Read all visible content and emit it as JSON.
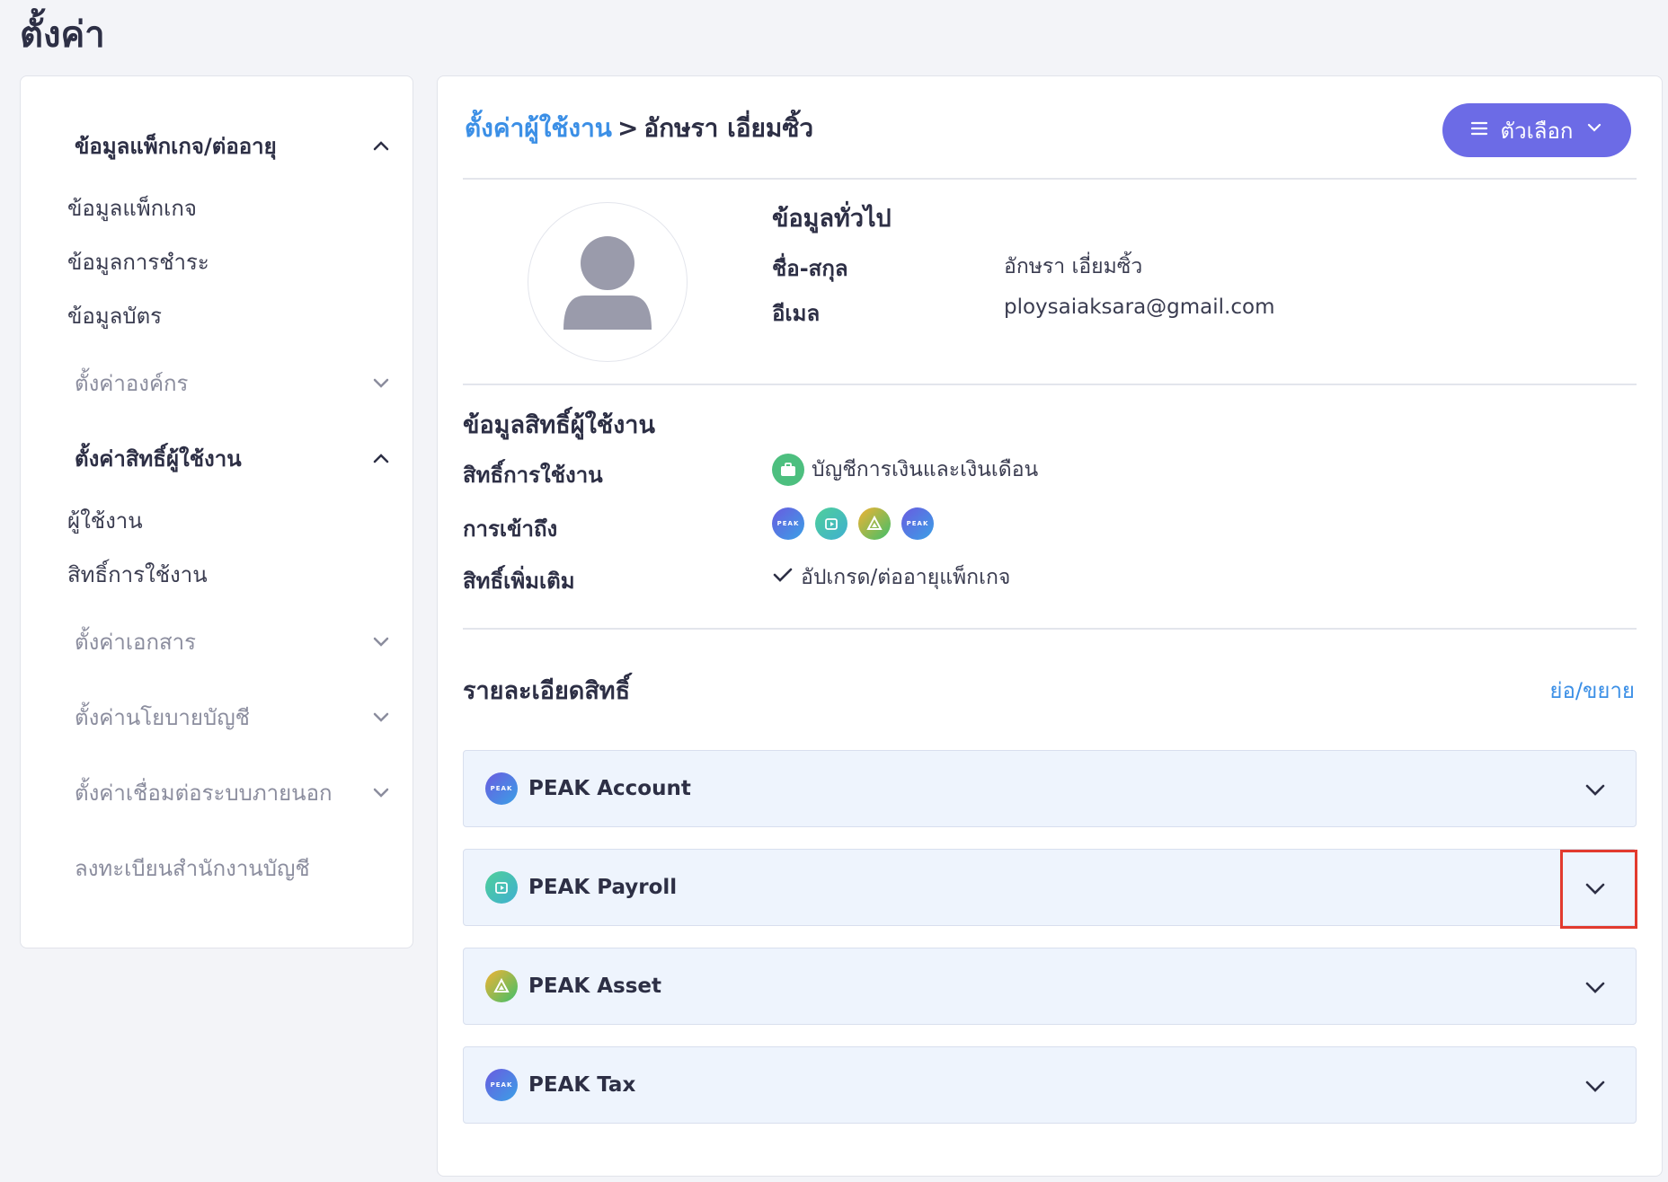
{
  "page_title": "ตั้งค่า",
  "sidebar": {
    "groups": [
      {
        "label": "ข้อมูลแพ็กเกจ/ต่ออายุ",
        "expanded": true,
        "items": [
          "ข้อมูลแพ็กเกจ",
          "ข้อมูลการชำระ",
          "ข้อมูลบัตร"
        ]
      },
      {
        "label": "ตั้งค่าองค์กร",
        "expanded": false
      },
      {
        "label": "ตั้งค่าสิทธิ์ผู้ใช้งาน",
        "expanded": true,
        "items": [
          "ผู้ใช้งาน",
          "สิทธิ์การใช้งาน"
        ]
      },
      {
        "label": "ตั้งค่าเอกสาร",
        "expanded": false
      },
      {
        "label": "ตั้งค่านโยบายบัญชี",
        "expanded": false
      },
      {
        "label": "ตั้งค่าเชื่อมต่อระบบภายนอก",
        "expanded": false
      },
      {
        "label": "ลงทะเบียนสำนักงานบัญชี"
      }
    ]
  },
  "breadcrumb": {
    "link": "ตั้งค่าผู้ใช้งาน",
    "separator": ">",
    "current": "อักษรา เอี่ยมซิ้ว"
  },
  "options_button": {
    "label": "ตัวเลือก"
  },
  "general": {
    "title": "ข้อมูลทั่วไป",
    "name_label": "ชื่อ-สกุล",
    "name_value": "อักษรา เอี่ยมซิ้ว",
    "email_label": "อีเมล",
    "email_value": "ploysaiaksara@gmail.com"
  },
  "permissions": {
    "title": "ข้อมูลสิทธิ์ผู้ใช้งาน",
    "usage_label": "สิทธิ์การใช้งาน",
    "usage_value": "บัญชีการเงินและเงินเดือน",
    "access_label": "การเข้าถึง",
    "extra_label": "สิทธิ์เพิ่มเติม",
    "extra_value": "อัปเกรด/ต่ออายุแพ็กเกจ"
  },
  "details": {
    "title": "รายละเอียดสิทธิ์",
    "toggle_label": "ย่อ/ขยาย",
    "apps": [
      {
        "name": "PEAK Account",
        "icon": "peak-account-icon"
      },
      {
        "name": "PEAK Payroll",
        "icon": "peak-payroll-icon"
      },
      {
        "name": "PEAK Asset",
        "icon": "peak-asset-icon"
      },
      {
        "name": "PEAK Tax",
        "icon": "peak-tax-icon"
      }
    ]
  },
  "colors": {
    "accent": "#6c6be6",
    "link": "#3b8fe6",
    "highlight": "#e23a2e"
  }
}
